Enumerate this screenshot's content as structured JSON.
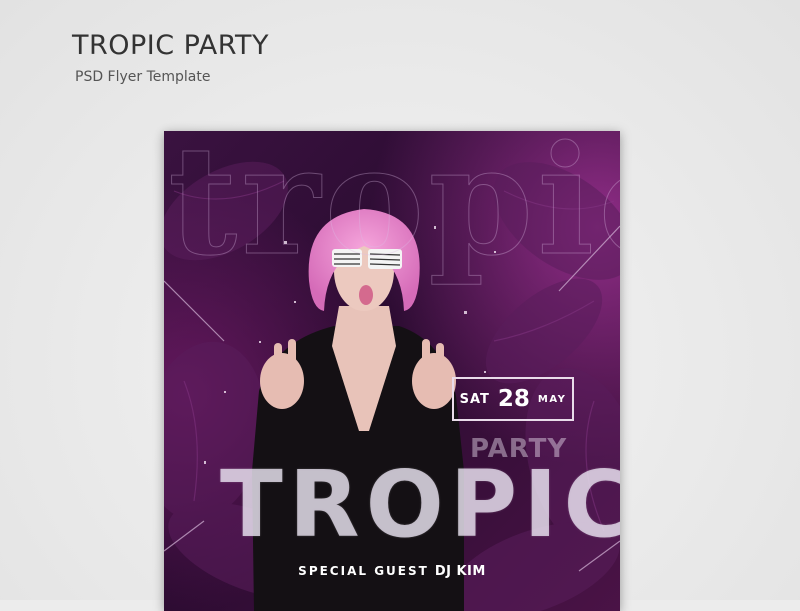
{
  "header": {
    "title": "TROPIC PARTY",
    "subtitle": "PSD Flyer Template"
  },
  "flyer": {
    "background_word": "tropic",
    "date": {
      "day": "SAT",
      "number": "28",
      "month": "MAY"
    },
    "party_label": "PARTY",
    "headline": "TROPIC",
    "special_guest_label": "SPECIAL GUEST",
    "dj_name": "DJ KIM"
  },
  "colors": {
    "page_background": "#ececec",
    "flyer_background": "#2a0c2e",
    "accent_pink": "#e07ac8",
    "text_white": "#ffffff"
  }
}
